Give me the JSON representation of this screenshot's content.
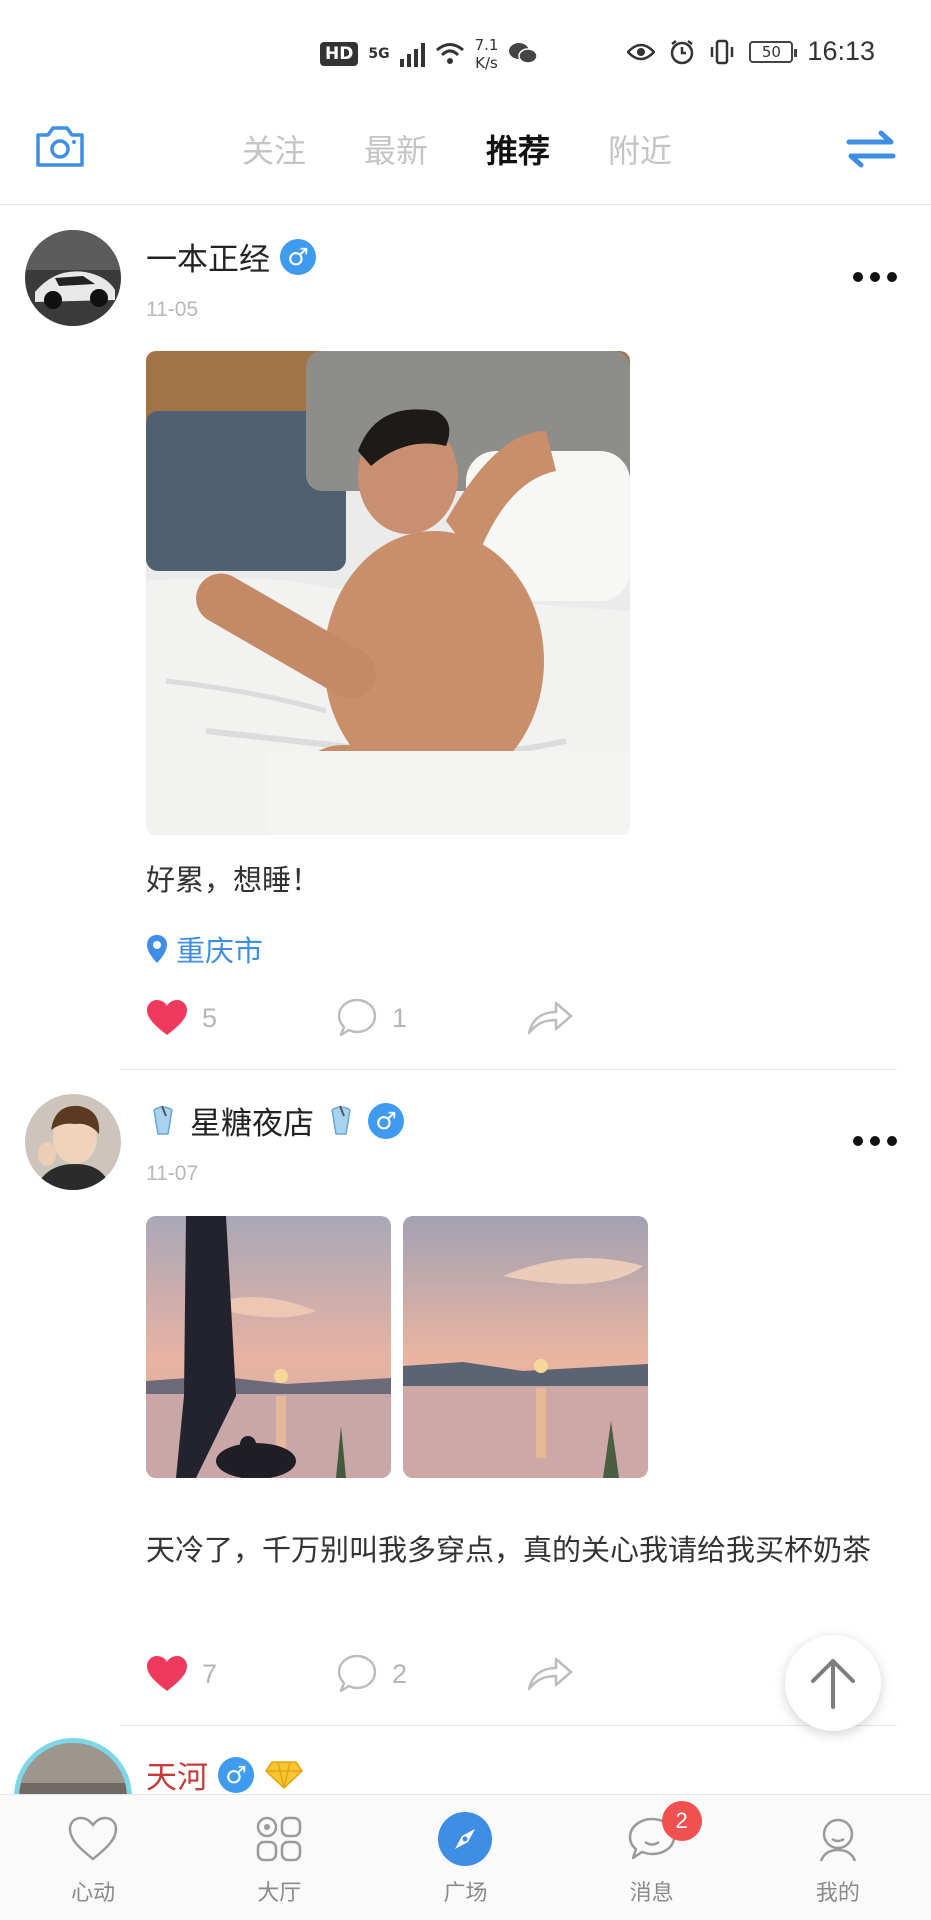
{
  "status_bar": {
    "hd": "HD",
    "network": "5G",
    "speed_value": "7.1",
    "speed_unit": "K/s",
    "battery": "50",
    "time": "16:13"
  },
  "top_nav": {
    "tabs": [
      {
        "label": "关注",
        "active": false
      },
      {
        "label": "最新",
        "active": false
      },
      {
        "label": "推荐",
        "active": true
      },
      {
        "label": "附近",
        "active": false
      }
    ]
  },
  "posts": [
    {
      "username": "一本正经",
      "gender": "♂",
      "date": "11-05",
      "text": "好累，想睡！",
      "location": "重庆市",
      "likes": "5",
      "comments": "1"
    },
    {
      "username": "星糖夜店",
      "gender": "♂",
      "date": "11-07",
      "text": "天冷了，千万别叫我多穿点，真的关心我请给我买杯奶茶",
      "likes": "7",
      "comments": "2"
    },
    {
      "username": "天河",
      "gender": "♂"
    }
  ],
  "bottom_nav": {
    "items": [
      {
        "label": "心动",
        "icon": "heart-outline-icon"
      },
      {
        "label": "大厅",
        "icon": "grid-icon"
      },
      {
        "label": "广场",
        "icon": "compass-icon",
        "active": true
      },
      {
        "label": "消息",
        "icon": "chat-bubble-icon",
        "badge": "2"
      },
      {
        "label": "我的",
        "icon": "profile-icon"
      }
    ]
  },
  "colors": {
    "accent": "#3f8ee5",
    "male_badge": "#3f9bef",
    "like_red": "#ef3a5d",
    "badge_red": "#f24f4f",
    "vip_name": "#c8393c"
  }
}
